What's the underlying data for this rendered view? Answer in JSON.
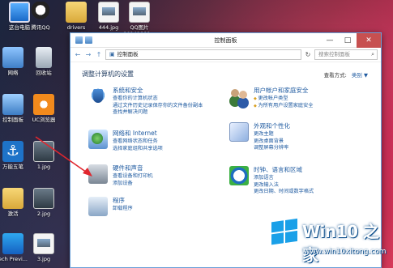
{
  "desktop": {
    "icons": [
      {
        "label": "这台电脑",
        "icon": "computer-icon"
      },
      {
        "label": "腾讯QQ",
        "icon": "qq-icon"
      },
      {
        "label": "drivers",
        "icon": "folder-icon"
      },
      {
        "label": "444.jpg",
        "icon": "image-icon"
      },
      {
        "label": "QQ图片\n20141009...",
        "icon": "image-icon"
      },
      {
        "label": "网络",
        "icon": "network-icon"
      },
      {
        "label": "回收站",
        "icon": "recycle-bin-icon"
      },
      {
        "label": "控制面板",
        "icon": "control-panel-icon"
      },
      {
        "label": "UC浏览器",
        "icon": "uc-browser-icon"
      },
      {
        "label": "万能五笔",
        "icon": "wubi-icon"
      },
      {
        "label": "1.jpg",
        "icon": "image-icon"
      },
      {
        "label": "激活",
        "icon": "folder-icon"
      },
      {
        "label": "2.jpg",
        "icon": "image-icon"
      },
      {
        "label": "ech Previ...",
        "icon": "windows-icon"
      },
      {
        "label": "3.jpg",
        "icon": "image-icon"
      }
    ]
  },
  "window": {
    "title": "控制面板",
    "address": "控制面板",
    "search_placeholder": "搜索控制面板",
    "heading": "调整计算机的设置",
    "view_by_label": "查看方式:",
    "view_by_value": "类别 ▼",
    "nav": {
      "back": "←",
      "forward": "→",
      "up": "↑",
      "refresh": "↻"
    },
    "controls": {
      "minimize": "—",
      "maximize": "□",
      "close": "✕"
    },
    "categories_left": [
      {
        "title": "系统和安全",
        "icon": "shield-icon",
        "links": [
          "查看你的计算机状态",
          "通过文件历史记录保存你的文件备份副本",
          "查找并解决问题"
        ]
      },
      {
        "title": "网络和 Internet",
        "icon": "network-globe-icon",
        "links": [
          "查看网络状态和任务",
          "选择家庭组和共享选项"
        ]
      },
      {
        "title": "硬件和声音",
        "icon": "printer-icon",
        "links": [
          "查看设备和打印机",
          "添加设备"
        ]
      },
      {
        "title": "程序",
        "icon": "programs-icon",
        "links": [
          "卸载程序"
        ]
      }
    ],
    "categories_right": [
      {
        "title": "用户帐户和家庭安全",
        "icon": "users-icon",
        "links": [
          "更改帐户类型",
          "为所有用户设置家庭安全"
        ]
      },
      {
        "title": "外观和个性化",
        "icon": "appearance-icon",
        "links": [
          "更改主题",
          "更改桌面背景",
          "调整屏幕分辨率"
        ]
      },
      {
        "title": "时钟、语言和区域",
        "icon": "clock-globe-icon",
        "links": [
          "添加语言",
          "更改输入法",
          "更改日期、时间或数字格式"
        ]
      }
    ]
  },
  "watermark": {
    "title": "Win10 之家",
    "url": "www.win10xitong.com"
  },
  "colors": {
    "link": "#1e5aa0",
    "close_button": "#c75050",
    "arrow": "#e0262e",
    "watermark_logo": "#1aa0e8"
  }
}
